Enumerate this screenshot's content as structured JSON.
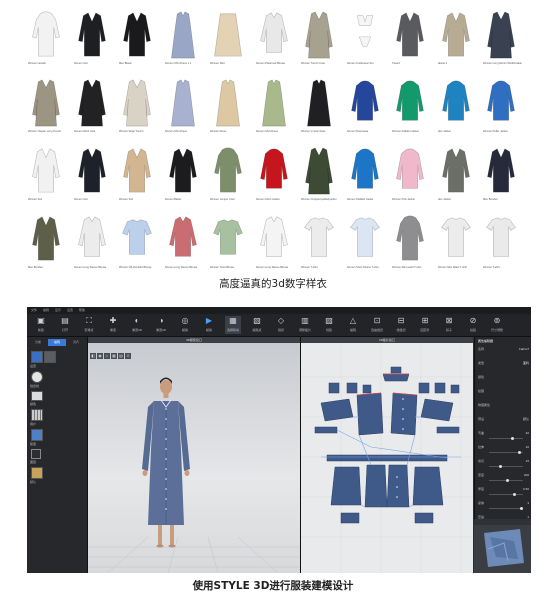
{
  "catalog": {
    "caption": "高度逼真的3d数字样衣",
    "rows": [
      [
        {
          "name": "Women Hoodie",
          "kind": "hoodie",
          "color": "#f2f2f2"
        },
        {
          "name": "Women Suit",
          "kind": "jacket",
          "color": "#1e1f22"
        },
        {
          "name": "Men Blazer",
          "kind": "jacket",
          "color": "#1a1a1c"
        },
        {
          "name": "Women Shirt Dress 1.1",
          "kind": "dress",
          "color": "#9aa6c6"
        },
        {
          "name": "Women Skirt",
          "kind": "skirt",
          "color": "#e4d2b4"
        },
        {
          "name": "Women Patterned Blouse",
          "kind": "shirt",
          "color": "#e8e8e8"
        },
        {
          "name": "Women Trench Coat",
          "kind": "coat",
          "color": "#a7a290"
        },
        {
          "name": "Women Underwear Set",
          "kind": "bikini",
          "color": "#f6f6f6"
        },
        {
          "name": "Tweed",
          "kind": "jacket",
          "color": "#595b5f"
        },
        {
          "name": "Jacket 2",
          "kind": "jacket",
          "color": "#b7ab94"
        },
        {
          "name": "Women Long Denim Windbreaker",
          "kind": "coat",
          "color": "#3a4252"
        }
      ],
      [
        {
          "name": "Women Classic Long Trench",
          "kind": "coat",
          "color": "#9c9583"
        },
        {
          "name": "Women Wool Coat",
          "kind": "coat",
          "color": "#222224"
        },
        {
          "name": "Women Wrap Trench",
          "kind": "coat",
          "color": "#d9d3c6"
        },
        {
          "name": "Women Shirt Dress",
          "kind": "dress",
          "color": "#a8b1cf"
        },
        {
          "name": "Women Dress",
          "kind": "dress",
          "color": "#ddc8a4"
        },
        {
          "name": "Women Shirt Dress",
          "kind": "dress",
          "color": "#a9b98c"
        },
        {
          "name": "Women V-neck dress",
          "kind": "dress",
          "color": "#202022"
        },
        {
          "name": "Women Downwear",
          "kind": "puffer",
          "color": "#24479c"
        },
        {
          "name": "Women Padded Jacket",
          "kind": "puffer",
          "color": "#139a6c"
        },
        {
          "name": "Men Jacket",
          "kind": "puffer",
          "color": "#1f83c2"
        },
        {
          "name": "Women Puffer Jacket",
          "kind": "puffer",
          "color": "#2f6ec0"
        }
      ],
      [
        {
          "name": "Women Suit",
          "kind": "jacket",
          "color": "#f1f1f1"
        },
        {
          "name": "Women Suit",
          "kind": "jacket",
          "color": "#1d2129"
        },
        {
          "name": "Women Suit",
          "kind": "jacket",
          "color": "#d2b691"
        },
        {
          "name": "Women Blazer",
          "kind": "jacket",
          "color": "#1c1c1f"
        },
        {
          "name": "Women Jumper Coat",
          "kind": "hoodie",
          "color": "#7d8f6a"
        },
        {
          "name": "Women Short Jacket",
          "kind": "puffer",
          "color": "#c4161c"
        },
        {
          "name": "Women Cropped quilted jacket",
          "kind": "coat",
          "color": "#3d4a34"
        },
        {
          "name": "Women Padded Jacket",
          "kind": "puffer",
          "color": "#1c75c6"
        },
        {
          "name": "Women Pink Jacket",
          "kind": "puffer",
          "color": "#f0b9cb"
        },
        {
          "name": "Men Jacket",
          "kind": "jacket",
          "color": "#6c6e68"
        },
        {
          "name": "Men Bomber",
          "kind": "jacket",
          "color": "#262a3a"
        }
      ],
      [
        {
          "name": "Men Bomber",
          "kind": "jacket",
          "color": "#5d5f48"
        },
        {
          "name": "Women Long Sleeve Blouse",
          "kind": "shirt",
          "color": "#ececec"
        },
        {
          "name": "Women Off-shoulder Blouse",
          "kind": "blouse",
          "color": "#bcd0ec"
        },
        {
          "name": "Women Long Sleeve Blouse",
          "kind": "shirt",
          "color": "#c96d72"
        },
        {
          "name": "Women Twist Blouse",
          "kind": "blouse",
          "color": "#a6c0a0"
        },
        {
          "name": "Women Long Sleeve Blouse",
          "kind": "shirt",
          "color": "#f4f4f4"
        },
        {
          "name": "Women T-shirt",
          "kind": "tee",
          "color": "#ececec"
        },
        {
          "name": "Women Short Sleeve T-shirt",
          "kind": "tee",
          "color": "#dbe6f2"
        },
        {
          "name": "Women Slim-waist T-shirt",
          "kind": "hoodie",
          "color": "#8e8e90"
        },
        {
          "name": "Women Slim Waist T-shirt",
          "kind": "tee",
          "color": "#ececec"
        },
        {
          "name": "Women T-shirt",
          "kind": "tee",
          "color": "#eaeaea"
        }
      ]
    ]
  },
  "app": {
    "caption": "使用STYLE 3D进行服装建模设计",
    "menu": [
      "文件",
      "编辑",
      "显示",
      "设置",
      "帮助"
    ],
    "toolbar": [
      {
        "icon": "▣",
        "label": "新建"
      },
      {
        "icon": "▤",
        "label": "打开"
      },
      {
        "icon": "⛶",
        "label": "安排点"
      },
      {
        "icon": "✚",
        "label": "重置"
      },
      {
        "icon": "◐",
        "label": "重置3D"
      },
      {
        "icon": "◑",
        "label": "重置2D"
      },
      {
        "icon": "◎",
        "label": "模拟"
      },
      {
        "icon": "▶",
        "label": "模拟"
      },
      {
        "icon": "▦",
        "label": "选择移动"
      },
      {
        "icon": "▧",
        "label": "编辑点"
      },
      {
        "icon": "◇",
        "label": "缝纫"
      },
      {
        "icon": "▥",
        "label": "调整板片"
      },
      {
        "icon": "▨",
        "label": "创建"
      },
      {
        "icon": "△",
        "label": "编辑"
      },
      {
        "icon": "⊡",
        "label": "自由缝纫"
      },
      {
        "icon": "⊟",
        "label": "线缝纫"
      },
      {
        "icon": "⊞",
        "label": "固定针"
      },
      {
        "icon": "⊠",
        "label": "扣子"
      },
      {
        "icon": "⊘",
        "label": "拉链"
      },
      {
        "icon": "⊚",
        "label": "尺寸调整"
      }
    ],
    "left_tabs": [
      "分类",
      "编辑",
      "对齐"
    ],
    "left_rows": [
      "设置",
      "缝合线",
      "颜色",
      "用户",
      "版型",
      "图层",
      "默认",
      "标准",
      "扣子"
    ],
    "viewport_title": "3D服装窗口",
    "pattern_title": "2D板片窗口",
    "right_panel": {
      "title": "属性编辑器",
      "rows": [
        {
          "label": "名称",
          "value": "Fabric7"
        },
        {
          "label": "类型",
          "value": "面料"
        },
        {
          "label": "颜色",
          "value": ""
        },
        {
          "label": "纹理",
          "value": ""
        },
        {
          "label": "物理属性",
          "value": ""
        },
        {
          "label": "预设",
          "value": "默认"
        },
        {
          "label": "弯曲",
          "value": "40"
        },
        {
          "label": "拉伸",
          "value": "10"
        },
        {
          "label": "剪切",
          "value": "15"
        },
        {
          "label": "密度",
          "value": "200"
        },
        {
          "label": "厚度",
          "value": "0.50"
        },
        {
          "label": "摩擦",
          "value": "3"
        },
        {
          "label": "压缩",
          "value": "1"
        }
      ]
    }
  },
  "colors": {
    "dress": "#5b6f98",
    "pattern_piece": "#3f5a88",
    "seam": "#e04848",
    "accent": "#3b7ad9"
  }
}
